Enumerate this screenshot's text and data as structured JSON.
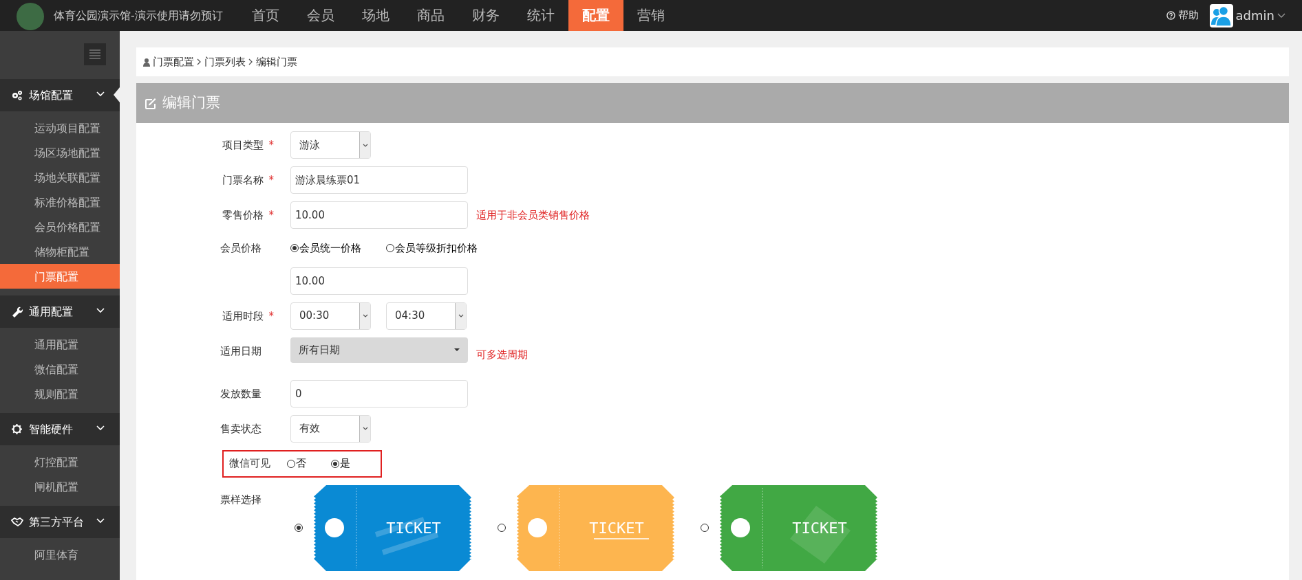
{
  "header": {
    "site_title": "体育公园演示馆-演示使用请勿预订",
    "nav": [
      {
        "label": "首页",
        "selected": false
      },
      {
        "label": "会员",
        "selected": false
      },
      {
        "label": "场地",
        "selected": false
      },
      {
        "label": "商品",
        "selected": false
      },
      {
        "label": "财务",
        "selected": false
      },
      {
        "label": "统计",
        "selected": false
      },
      {
        "label": "配置",
        "selected": true
      },
      {
        "label": "营销",
        "selected": false
      }
    ],
    "help": "帮助",
    "user": "admin"
  },
  "sidebar": {
    "groups": [
      {
        "label": "场馆配置",
        "expanded": true,
        "items": [
          {
            "label": "运动项目配置",
            "selected": false
          },
          {
            "label": "场区场地配置",
            "selected": false
          },
          {
            "label": "场地关联配置",
            "selected": false
          },
          {
            "label": "标准价格配置",
            "selected": false
          },
          {
            "label": "会员价格配置",
            "selected": false
          },
          {
            "label": "储物柜配置",
            "selected": false
          },
          {
            "label": "门票配置",
            "selected": true
          }
        ]
      },
      {
        "label": "通用配置",
        "expanded": true,
        "items": [
          {
            "label": "通用配置",
            "selected": false
          },
          {
            "label": "微信配置",
            "selected": false
          },
          {
            "label": "规则配置",
            "selected": false
          }
        ]
      },
      {
        "label": "智能硬件",
        "expanded": true,
        "items": [
          {
            "label": "灯控配置",
            "selected": false
          },
          {
            "label": "闸机配置",
            "selected": false
          }
        ]
      },
      {
        "label": "第三方平台",
        "expanded": true,
        "items": [
          {
            "label": "阿里体育",
            "selected": false
          }
        ]
      }
    ]
  },
  "breadcrumb": [
    "门票配置",
    "门票列表",
    "编辑门票"
  ],
  "panel": {
    "title": "编辑门票",
    "fields": [
      {
        "kind": "select",
        "label": "项目类型",
        "required_mark": "*",
        "value": "游泳"
      },
      {
        "kind": "text",
        "label": "门票名称",
        "required_mark": "*",
        "value": "游泳晨练票01"
      },
      {
        "kind": "text",
        "label": "零售价格",
        "required_mark": "*",
        "value": "10.00",
        "hint": "适用于非会员类销售价格"
      },
      {
        "kind": "radio_text",
        "label": "会员价格",
        "options": [
          {
            "label": "会员统一价格",
            "selected": true
          },
          {
            "label": "会员等级折扣价格",
            "selected": false
          }
        ],
        "value": "10.00"
      },
      {
        "kind": "time_range",
        "label": "适用时段",
        "required_mark": "*",
        "values": [
          "00:30",
          "04:30"
        ]
      },
      {
        "kind": "dropdown",
        "label": "适用日期",
        "value": "所有日期",
        "hint": "可多选周期"
      },
      {
        "kind": "text",
        "label": "发放数量",
        "value": "0"
      },
      {
        "kind": "select",
        "label": "售卖状态",
        "value": "有效"
      },
      {
        "kind": "radio",
        "label": "微信可见",
        "highlighted": true,
        "options": [
          {
            "label": "否",
            "selected": false
          },
          {
            "label": "是",
            "selected": true
          }
        ]
      },
      {
        "kind": "tickets",
        "label": "票样选择",
        "options": [
          {
            "text": "TICKET",
            "color": "#0a8ad4",
            "selected": true
          },
          {
            "text": "TICKET",
            "color": "#fdb54f",
            "selected": false
          },
          {
            "text": "TICKET",
            "color": "#41a844",
            "selected": false
          }
        ]
      }
    ]
  }
}
